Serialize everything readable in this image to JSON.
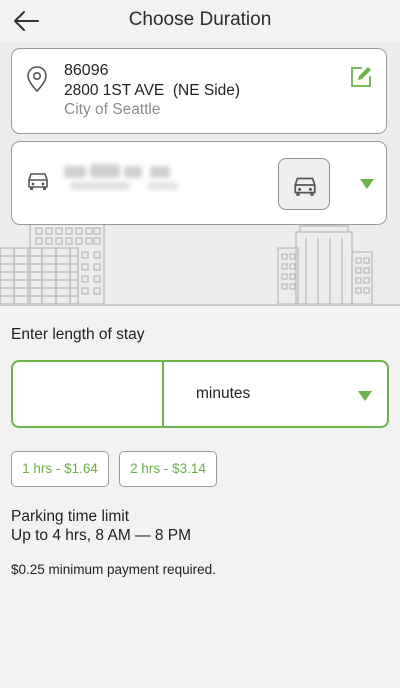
{
  "header": {
    "title": "Choose Duration",
    "back_icon": "arrow-left-icon"
  },
  "location": {
    "zone_number": "86096",
    "address": "2800 1ST AVE  (NE Side)",
    "city": "City of Seattle",
    "pin_icon": "location-pin-icon",
    "edit_icon": "edit-icon"
  },
  "vehicle": {
    "car_icon": "car-icon",
    "plate": "",
    "dropdown_icon": "dropdown-triangle-icon"
  },
  "duration": {
    "label": "Enter length of stay",
    "value": "",
    "placeholder": "",
    "unit": "minutes"
  },
  "quick_options": [
    {
      "label": "1 hrs - $1.64"
    },
    {
      "label": "2 hrs - $3.14"
    }
  ],
  "limits": {
    "title": "Parking time limit",
    "value": "Up to 4 hrs, 8 AM — 8 PM",
    "minimum": "$0.25 minimum payment required."
  },
  "colors": {
    "accent": "#6cb34a",
    "background": "#f2f2f2",
    "border": "#9a9a9a"
  }
}
